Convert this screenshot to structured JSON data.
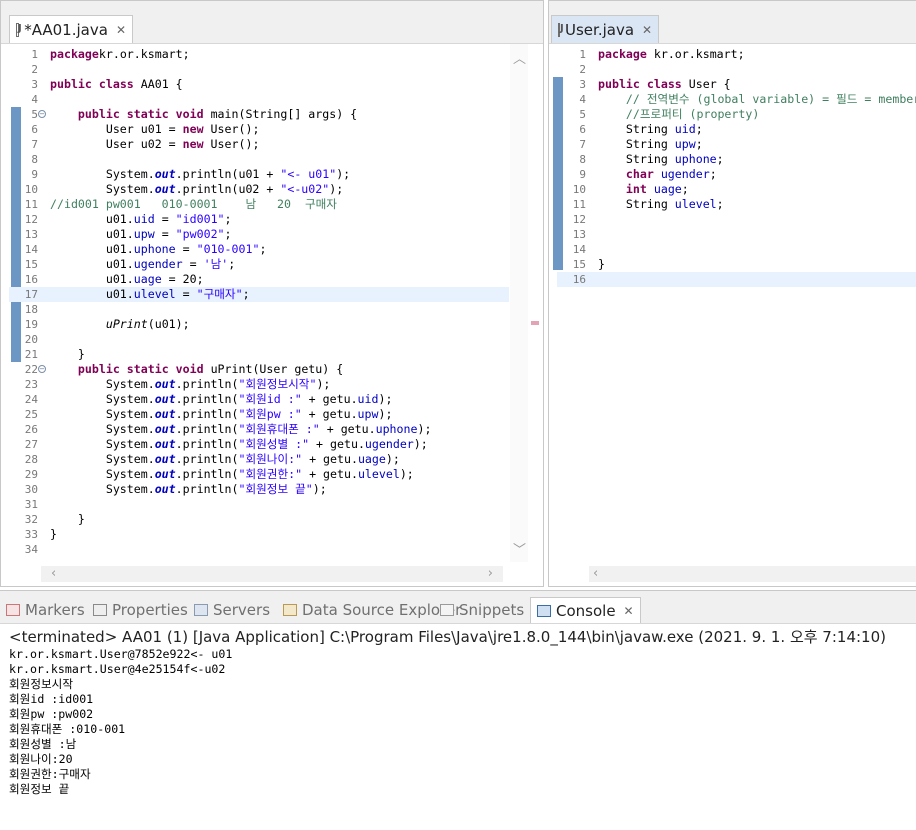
{
  "left_editor": {
    "tab_label": "*AA01.java",
    "lines": [
      {
        "n": "1",
        "segs": [
          [
            "kw",
            "package"
          ],
          [
            "",
            "kr.or.ksmart;"
          ]
        ]
      },
      {
        "n": "2",
        "segs": []
      },
      {
        "n": "3",
        "segs": [
          [
            "kw",
            "public"
          ],
          [
            "",
            " "
          ],
          [
            "kw",
            "class"
          ],
          [
            "",
            " AA01 {"
          ]
        ]
      },
      {
        "n": "4",
        "segs": []
      },
      {
        "n": "5",
        "fold": "−",
        "segs": [
          [
            "",
            "    "
          ],
          [
            "kw",
            "public"
          ],
          [
            "",
            " "
          ],
          [
            "kw",
            "static"
          ],
          [
            "",
            " "
          ],
          [
            "kw",
            "void"
          ],
          [
            "",
            " main(String[] args) {"
          ]
        ]
      },
      {
        "n": "6",
        "segs": [
          [
            "",
            "        User u01 = "
          ],
          [
            "kw",
            "new"
          ],
          [
            "",
            " User();"
          ]
        ]
      },
      {
        "n": "7",
        "segs": [
          [
            "",
            "        User u02 = "
          ],
          [
            "kw",
            "new"
          ],
          [
            "",
            " User();"
          ]
        ]
      },
      {
        "n": "8",
        "segs": []
      },
      {
        "n": "9",
        "segs": [
          [
            "",
            "        System."
          ],
          [
            "sfld",
            "out"
          ],
          [
            "",
            ".println(u01 + "
          ],
          [
            "str",
            "\"<- u01\""
          ],
          [
            "",
            ");"
          ]
        ]
      },
      {
        "n": "10",
        "segs": [
          [
            "",
            "        System."
          ],
          [
            "sfld",
            "out"
          ],
          [
            "",
            ".println(u02 + "
          ],
          [
            "str",
            "\"<-u02\""
          ],
          [
            "",
            ");"
          ]
        ]
      },
      {
        "n": "11",
        "segs": [
          [
            "cmt",
            "//id001 pw001   010-0001    남   20  구매자"
          ]
        ]
      },
      {
        "n": "12",
        "segs": [
          [
            "",
            "        u01."
          ],
          [
            "fld",
            "uid"
          ],
          [
            "",
            " = "
          ],
          [
            "str",
            "\"id001\""
          ],
          [
            "",
            ";"
          ]
        ]
      },
      {
        "n": "13",
        "segs": [
          [
            "",
            "        u01."
          ],
          [
            "fld",
            "upw"
          ],
          [
            "",
            " = "
          ],
          [
            "str",
            "\"pw002\""
          ],
          [
            "",
            ";"
          ]
        ]
      },
      {
        "n": "14",
        "segs": [
          [
            "",
            "        u01."
          ],
          [
            "fld",
            "uphone"
          ],
          [
            "",
            " = "
          ],
          [
            "str",
            "\"010-001\""
          ],
          [
            "",
            ";"
          ]
        ]
      },
      {
        "n": "15",
        "segs": [
          [
            "",
            "        u01."
          ],
          [
            "fld",
            "ugender"
          ],
          [
            "",
            " = "
          ],
          [
            "str",
            "'남'"
          ],
          [
            "",
            ";"
          ]
        ]
      },
      {
        "n": "16",
        "segs": [
          [
            "",
            "        u01."
          ],
          [
            "fld",
            "uage"
          ],
          [
            "",
            " = 20;"
          ]
        ]
      },
      {
        "n": "17",
        "hl": true,
        "segs": [
          [
            "",
            "        u01."
          ],
          [
            "fld",
            "ulevel"
          ],
          [
            "",
            " = "
          ],
          [
            "str",
            "\"구매자\""
          ],
          [
            "",
            ";"
          ]
        ]
      },
      {
        "n": "18",
        "segs": []
      },
      {
        "n": "19",
        "segs": [
          [
            "",
            "        "
          ],
          [
            "mth",
            "uPrint"
          ],
          [
            "",
            "(u01);"
          ]
        ]
      },
      {
        "n": "20",
        "segs": []
      },
      {
        "n": "21",
        "segs": [
          [
            "",
            "    }"
          ]
        ]
      },
      {
        "n": "22",
        "fold": "−",
        "segs": [
          [
            "",
            "    "
          ],
          [
            "kw",
            "public"
          ],
          [
            "",
            " "
          ],
          [
            "kw",
            "static"
          ],
          [
            "",
            " "
          ],
          [
            "kw",
            "void"
          ],
          [
            "",
            " uPrint(User getu) {"
          ]
        ]
      },
      {
        "n": "23",
        "segs": [
          [
            "",
            "        System."
          ],
          [
            "sfld",
            "out"
          ],
          [
            "",
            ".println("
          ],
          [
            "str",
            "\"회원정보시작\""
          ],
          [
            "",
            ");"
          ]
        ]
      },
      {
        "n": "24",
        "segs": [
          [
            "",
            "        System."
          ],
          [
            "sfld",
            "out"
          ],
          [
            "",
            ".println("
          ],
          [
            "str",
            "\"회원id :\""
          ],
          [
            "",
            " + getu."
          ],
          [
            "fld",
            "uid"
          ],
          [
            "",
            ");"
          ]
        ]
      },
      {
        "n": "25",
        "segs": [
          [
            "",
            "        System."
          ],
          [
            "sfld",
            "out"
          ],
          [
            "",
            ".println("
          ],
          [
            "str",
            "\"회원pw :\""
          ],
          [
            "",
            " + getu."
          ],
          [
            "fld",
            "upw"
          ],
          [
            "",
            ");"
          ]
        ]
      },
      {
        "n": "26",
        "segs": [
          [
            "",
            "        System."
          ],
          [
            "sfld",
            "out"
          ],
          [
            "",
            ".println("
          ],
          [
            "str",
            "\"회원휴대폰 :\""
          ],
          [
            "",
            " + getu."
          ],
          [
            "fld",
            "uphone"
          ],
          [
            "",
            ");"
          ]
        ]
      },
      {
        "n": "27",
        "segs": [
          [
            "",
            "        System."
          ],
          [
            "sfld",
            "out"
          ],
          [
            "",
            ".println("
          ],
          [
            "str",
            "\"회원성별 :\""
          ],
          [
            "",
            " + getu."
          ],
          [
            "fld",
            "ugender"
          ],
          [
            "",
            ");"
          ]
        ]
      },
      {
        "n": "28",
        "segs": [
          [
            "",
            "        System."
          ],
          [
            "sfld",
            "out"
          ],
          [
            "",
            ".println("
          ],
          [
            "str",
            "\"회원나이:\""
          ],
          [
            "",
            " + getu."
          ],
          [
            "fld",
            "uage"
          ],
          [
            "",
            ");"
          ]
        ]
      },
      {
        "n": "29",
        "segs": [
          [
            "",
            "        System."
          ],
          [
            "sfld",
            "out"
          ],
          [
            "",
            ".println("
          ],
          [
            "str",
            "\"회원권한:\""
          ],
          [
            "",
            " + getu."
          ],
          [
            "fld",
            "ulevel"
          ],
          [
            "",
            ");"
          ]
        ]
      },
      {
        "n": "30",
        "segs": [
          [
            "",
            "        System."
          ],
          [
            "sfld",
            "out"
          ],
          [
            "",
            ".println("
          ],
          [
            "str",
            "\"회원정보 끝\""
          ],
          [
            "",
            ");"
          ]
        ]
      },
      {
        "n": "31",
        "segs": []
      },
      {
        "n": "32",
        "segs": [
          [
            "",
            "    }"
          ]
        ]
      },
      {
        "n": "33",
        "segs": [
          [
            "",
            "}"
          ]
        ]
      },
      {
        "n": "34",
        "segs": []
      }
    ]
  },
  "right_editor": {
    "tab_label": "User.java",
    "lines": [
      {
        "n": "1",
        "segs": [
          [
            "kw",
            "package"
          ],
          [
            "",
            " kr.or.ksmart;"
          ]
        ]
      },
      {
        "n": "2",
        "segs": []
      },
      {
        "n": "3",
        "segs": [
          [
            "kw",
            "public"
          ],
          [
            "",
            " "
          ],
          [
            "kw",
            "class"
          ],
          [
            "",
            " User {"
          ]
        ]
      },
      {
        "n": "4",
        "segs": [
          [
            "cmt",
            "    // 전역변수 (global variable) = 필드 = member"
          ]
        ]
      },
      {
        "n": "5",
        "segs": [
          [
            "cmt",
            "    //프로퍼티 (property)"
          ]
        ]
      },
      {
        "n": "6",
        "segs": [
          [
            "",
            "    String "
          ],
          [
            "fld",
            "uid"
          ],
          [
            "",
            ";"
          ]
        ]
      },
      {
        "n": "7",
        "segs": [
          [
            "",
            "    String "
          ],
          [
            "fld",
            "upw"
          ],
          [
            "",
            ";"
          ]
        ]
      },
      {
        "n": "8",
        "segs": [
          [
            "",
            "    String "
          ],
          [
            "fld",
            "uphone"
          ],
          [
            "",
            ";"
          ]
        ]
      },
      {
        "n": "9",
        "segs": [
          [
            "",
            "    "
          ],
          [
            "kw",
            "char"
          ],
          [
            "",
            " "
          ],
          [
            "fld",
            "ugender"
          ],
          [
            "",
            ";"
          ]
        ]
      },
      {
        "n": "10",
        "segs": [
          [
            "",
            "    "
          ],
          [
            "kw",
            "int"
          ],
          [
            "",
            " "
          ],
          [
            "fld",
            "uage"
          ],
          [
            "",
            ";"
          ]
        ]
      },
      {
        "n": "11",
        "segs": [
          [
            "",
            "    String "
          ],
          [
            "fld",
            "ulevel"
          ],
          [
            "",
            ";"
          ]
        ]
      },
      {
        "n": "12",
        "segs": []
      },
      {
        "n": "13",
        "segs": []
      },
      {
        "n": "14",
        "segs": []
      },
      {
        "n": "15",
        "segs": [
          [
            "",
            "}"
          ]
        ]
      },
      {
        "n": "16",
        "hl": true,
        "segs": []
      }
    ]
  },
  "bottom_tabs": [
    {
      "label": "Markers",
      "icon": "markers-icon"
    },
    {
      "label": "Properties",
      "icon": "properties-icon"
    },
    {
      "label": "Servers",
      "icon": "servers-icon"
    },
    {
      "label": "Data Source Explorer",
      "icon": "data-source-icon"
    },
    {
      "label": "Snippets",
      "icon": "snippets-icon"
    },
    {
      "label": "Console",
      "icon": "console-icon",
      "active": true
    }
  ],
  "console": {
    "status": "<terminated> AA01 (1) [Java Application] C:\\Program Files\\Java\\jre1.8.0_144\\bin\\javaw.exe (2021. 9. 1. 오후 7:14:10)",
    "output": [
      "kr.or.ksmart.User@7852e922<- u01",
      "kr.or.ksmart.User@4e25154f<-u02",
      "회원정보시작",
      "회원id :id001",
      "회원pw :pw002",
      "회원휴대폰 :010-001",
      "회원성별 :남",
      "회원나이:20",
      "회원권한:구매자",
      "회원정보 끝"
    ]
  },
  "colors": {
    "quick_diff": "#6c96c4",
    "current_line": "#e8f2fe",
    "keyword": "#7f0055",
    "string": "#2a00ff",
    "comment": "#3f7f5f",
    "field": "#0000c0"
  }
}
